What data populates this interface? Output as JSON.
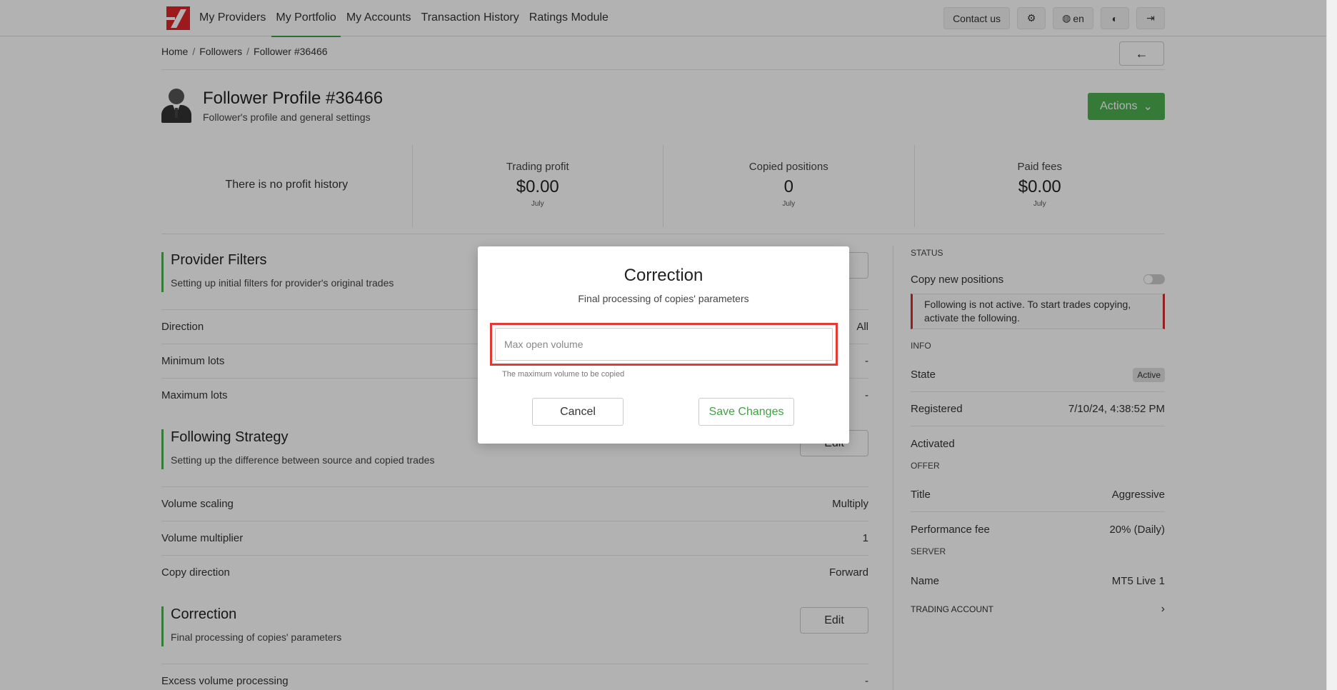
{
  "nav": {
    "items": [
      {
        "label": "My Providers"
      },
      {
        "label": "My Portfolio"
      },
      {
        "label": "My Accounts"
      },
      {
        "label": "Transaction History"
      },
      {
        "label": "Ratings Module"
      }
    ],
    "contact_label": "Contact us",
    "lang_label": "en"
  },
  "breadcrumb": [
    "Home",
    "Followers",
    "Follower #36466"
  ],
  "profile": {
    "title": "Follower Profile #36466",
    "subtitle": "Follower's profile and general settings",
    "actions_label": "Actions"
  },
  "stats": {
    "no_history": "There is no profit history",
    "items": [
      {
        "label": "Trading profit",
        "value": "$0.00",
        "period": "July"
      },
      {
        "label": "Copied positions",
        "value": "0",
        "period": "July"
      },
      {
        "label": "Paid fees",
        "value": "$0.00",
        "period": "July"
      }
    ]
  },
  "provider_filters": {
    "title": "Provider Filters",
    "subtitle": "Setting up initial filters for provider's original trades",
    "rows": [
      {
        "label": "Direction",
        "value": "All"
      },
      {
        "label": "Minimum lots",
        "value": "-"
      },
      {
        "label": "Maximum lots",
        "value": "-"
      }
    ]
  },
  "following_strategy": {
    "title": "Following Strategy",
    "subtitle": "Setting up the difference between source and copied trades",
    "edit_label": "Edit",
    "rows": [
      {
        "label": "Volume scaling",
        "value": "Multiply"
      },
      {
        "label": "Volume multiplier",
        "value": "1"
      },
      {
        "label": "Copy direction",
        "value": "Forward"
      }
    ]
  },
  "correction_section": {
    "title": "Correction",
    "subtitle": "Final processing of copies' parameters",
    "edit_label": "Edit",
    "rows": [
      {
        "label": "Excess volume processing",
        "value": "-"
      }
    ]
  },
  "sidebar": {
    "status_caption": "STATUS",
    "copy_new_positions": "Copy new positions",
    "warning": "Following is not active. To start trades copying, activate the following.",
    "info_caption": "INFO",
    "state_label": "State",
    "state_value": "Active",
    "registered_label": "Registered",
    "registered_value": "7/10/24, 4:38:52 PM",
    "activated_label": "Activated",
    "offer_caption": "OFFER",
    "title_label": "Title",
    "title_value": "Aggressive",
    "fee_label": "Performance fee",
    "fee_value": "20% (Daily)",
    "server_caption": "SERVER",
    "name_label": "Name",
    "name_value": "MT5 Live 1",
    "trading_account_caption": "TRADING ACCOUNT"
  },
  "modal": {
    "title": "Correction",
    "subtitle": "Final processing of copies' parameters",
    "input_placeholder": "Max open volume",
    "input_value": "",
    "help": "The maximum volume to be copied",
    "cancel_label": "Cancel",
    "save_label": "Save Changes"
  },
  "colors": {
    "accent_green": "#4caf50",
    "brand_red": "#e0242a",
    "highlight_red": "#e53935"
  }
}
